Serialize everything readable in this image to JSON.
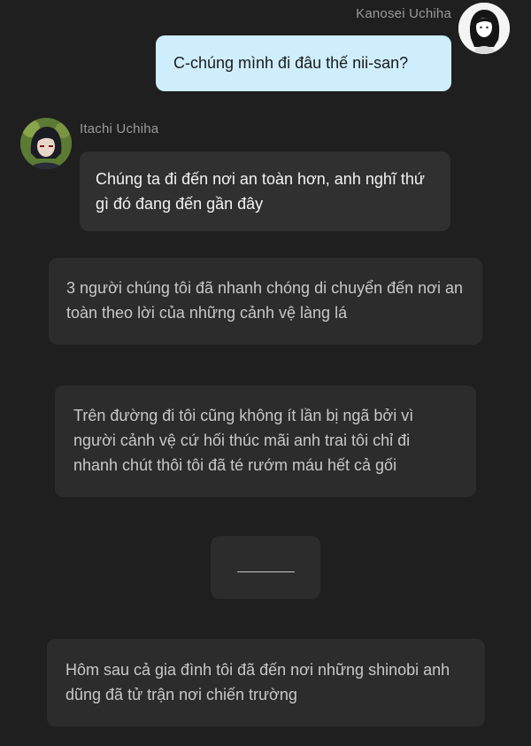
{
  "user": {
    "name": "Kanosei Uchiha",
    "message": "C-chúng mình đi đâu thế nii-san?"
  },
  "character": {
    "name": "Itachi Uchiha",
    "message": "Chúng ta đi đến nơi an toàn hơn, anh nghĩ thứ gì đó đang đến gần đây"
  },
  "narration": [
    "3 người chúng tôi đã nhanh chóng di chuyển đến nơi an toàn theo lời của những cảnh vệ làng lá",
    "Trên đường đi tôi cũng không ít lần bị ngã bởi vì người cảnh vệ cứ hối thúc mãi anh trai tôi chỉ đi nhanh chút thôi tôi đã té rướm máu hết cả gối",
    "________",
    "Hôm sau cả gia đình tôi đã đến nơi những shinobi anh dũng đã tử trận nơi chiến trường"
  ],
  "colors": {
    "background": "#1f1f1f",
    "user_bubble": "#cfeefd",
    "char_bubble": "#303030",
    "narration_bubble": "#2c2c2c"
  }
}
